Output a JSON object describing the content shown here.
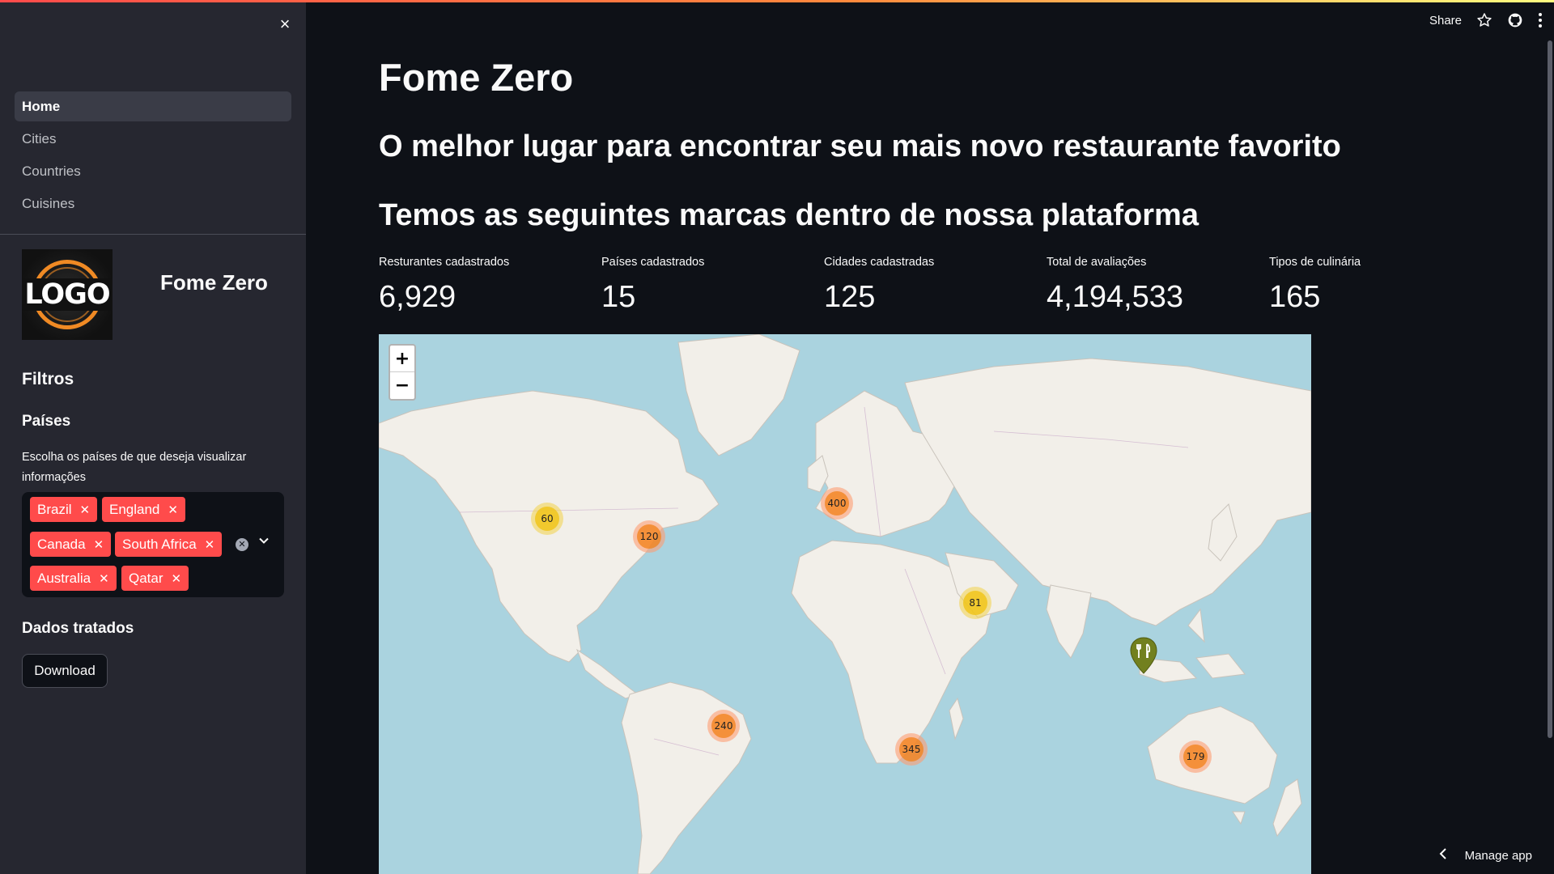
{
  "header": {
    "share_label": "Share",
    "icons": [
      "star-icon",
      "github-icon",
      "more-vertical-icon"
    ]
  },
  "sidebar": {
    "close_icon": "×",
    "nav": [
      {
        "label": "Home",
        "active": true
      },
      {
        "label": "Cities",
        "active": false
      },
      {
        "label": "Countries",
        "active": false
      },
      {
        "label": "Cuisines",
        "active": false
      }
    ],
    "logo_text": "LOGO",
    "brand_name": "Fome Zero",
    "filters_title": "Filtros",
    "paises_title": "Países",
    "paises_help": "Escolha os países de que deseja visualizar informações",
    "selected_countries": [
      "Brazil",
      "England",
      "Canada",
      "South Africa",
      "Australia",
      "Qatar"
    ],
    "dados_title": "Dados tratados",
    "download_label": "Download"
  },
  "main": {
    "title": "Fome Zero",
    "subtitle": "O melhor lugar para encontrar seu mais novo restaurante favorito",
    "section_title": "Temos as seguintes marcas dentro de nossa plataforma",
    "metrics": [
      {
        "label": "Resturantes cadastrados",
        "value": "6,929"
      },
      {
        "label": "Países cadastrados",
        "value": "15"
      },
      {
        "label": "Cidades cadastradas",
        "value": "125"
      },
      {
        "label": "Total de avaliações",
        "value": "4,194,533"
      },
      {
        "label": "Tipos de culinária",
        "value": "165"
      }
    ]
  },
  "map": {
    "zoom_in": "+",
    "zoom_out": "−",
    "clusters": [
      {
        "count": "60",
        "color": "yellow"
      },
      {
        "count": "120",
        "color": "orange"
      },
      {
        "count": "400",
        "color": "orange"
      },
      {
        "count": "81",
        "color": "yellow"
      },
      {
        "count": "240",
        "color": "orange"
      },
      {
        "count": "345",
        "color": "orange"
      },
      {
        "count": "179",
        "color": "orange"
      }
    ],
    "land_color": "#f2efe9",
    "water_color": "#aad3df",
    "pin_color": "#72801f"
  },
  "footer": {
    "manage_label": "Manage app"
  }
}
